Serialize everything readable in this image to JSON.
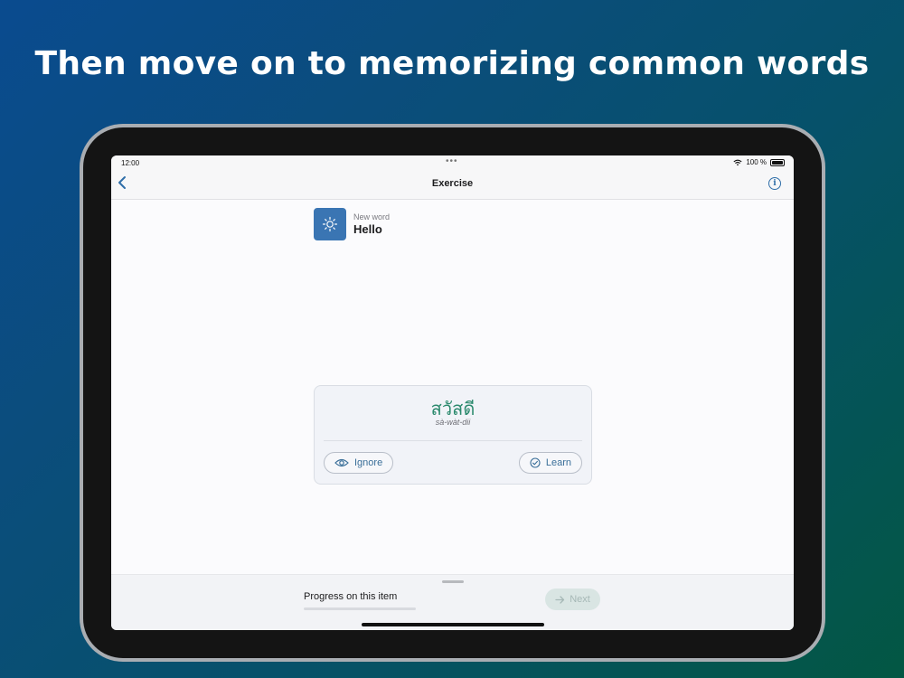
{
  "headline": "Then move on to memorizing common words",
  "status_bar": {
    "time": "12:00",
    "battery": "100 %"
  },
  "nav": {
    "title": "Exercise",
    "info_glyph": "i"
  },
  "word_header": {
    "label": "New word",
    "value": "Hello",
    "icon": "sun-icon"
  },
  "card": {
    "thai": "สวัสดี",
    "transliteration": "sà-wàt-dii",
    "ignore_label": "Ignore",
    "learn_label": "Learn"
  },
  "bottom_sheet": {
    "progress_label": "Progress on this item",
    "progress_fraction": 0,
    "next_label": "Next",
    "next_enabled": false
  },
  "colors": {
    "accent": "#2f6ea8",
    "thai_text": "#2c8a6e",
    "icon_tile": "#3a75b3"
  }
}
